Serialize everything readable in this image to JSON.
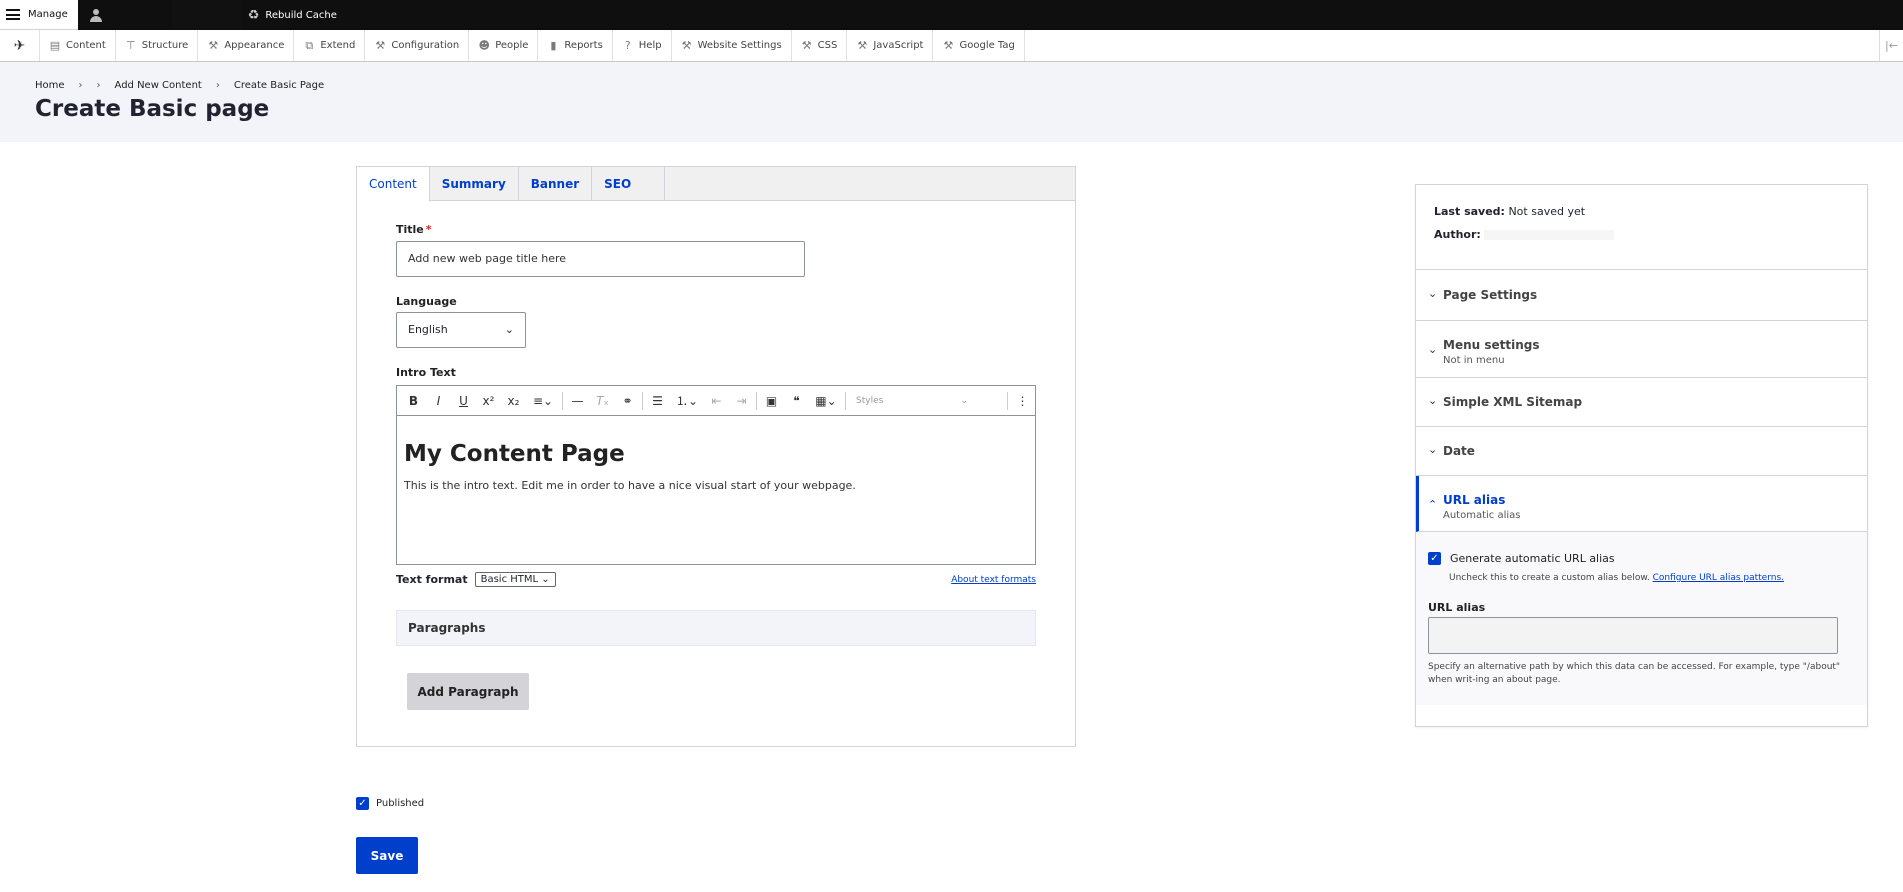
{
  "toolbar": {
    "manage_label": "Manage",
    "rebuild_label": "Rebuild Cache"
  },
  "admin_menu": [
    {
      "label": "Content",
      "icon": "page"
    },
    {
      "label": "Structure",
      "icon": "sitemap"
    },
    {
      "label": "Appearance",
      "icon": "wrench"
    },
    {
      "label": "Extend",
      "icon": "puzzle"
    },
    {
      "label": "Configuration",
      "icon": "wrench"
    },
    {
      "label": "People",
      "icon": "person"
    },
    {
      "label": "Reports",
      "icon": "bar-chart"
    },
    {
      "label": "Help",
      "icon": "question"
    },
    {
      "label": "Website Settings",
      "icon": "wrench"
    },
    {
      "label": "CSS",
      "icon": "wrench"
    },
    {
      "label": "JavaScript",
      "icon": "wrench"
    },
    {
      "label": "Google Tag",
      "icon": "wrench"
    }
  ],
  "breadcrumb": {
    "items": [
      "Home",
      "",
      "Add New Content",
      "Create Basic Page"
    ],
    "separator": "›"
  },
  "page_title": "Create Basic page",
  "tabs": [
    {
      "label": "Content",
      "active": true
    },
    {
      "label": "Summary"
    },
    {
      "label": "Banner"
    },
    {
      "label": "SEO"
    }
  ],
  "form": {
    "title_label": "Title",
    "title_required": "*",
    "title_value": "Add new web page title here",
    "language_label": "Language",
    "language_value": "English",
    "intro_label": "Intro Text",
    "styles_placeholder": "Styles",
    "editor_heading": "My Content Page",
    "editor_paragraph": "This is the intro text. Edit me in order to have a nice visual start of your webpage.",
    "text_format_label": "Text format",
    "text_format_value": "Basic HTML",
    "about_formats_link": "About text formats",
    "paragraphs_label": "Paragraphs",
    "add_paragraph_label": "Add Paragraph"
  },
  "published": {
    "label": "Published",
    "checked": true
  },
  "save_label": "Save",
  "sidebar": {
    "last_saved_label": "Last saved:",
    "last_saved_value": "Not saved yet",
    "author_label": "Author:",
    "sections": [
      {
        "title": "Page Settings",
        "subtitle": ""
      },
      {
        "title": "Menu settings",
        "subtitle": "Not in menu"
      },
      {
        "title": "Simple XML Sitemap",
        "subtitle": ""
      },
      {
        "title": "Date",
        "subtitle": ""
      },
      {
        "title": "URL alias",
        "subtitle": "Automatic alias",
        "open": true
      }
    ],
    "alias": {
      "generate_label": "Generate automatic URL alias",
      "generate_checked": true,
      "uncheck_text": "Uncheck this to create a custom alias below.",
      "configure_link": "Configure URL alias patterns.",
      "url_alias_label": "URL alias",
      "url_alias_value": "",
      "help_text": "Specify an alternative path by which this data can be accessed. For example, type \"/about\" when writ-ing an about page."
    }
  },
  "colors": {
    "accent": "#003ecc",
    "header_bg": "#f3f4f9",
    "topbar_bg": "#0f0f0f"
  }
}
